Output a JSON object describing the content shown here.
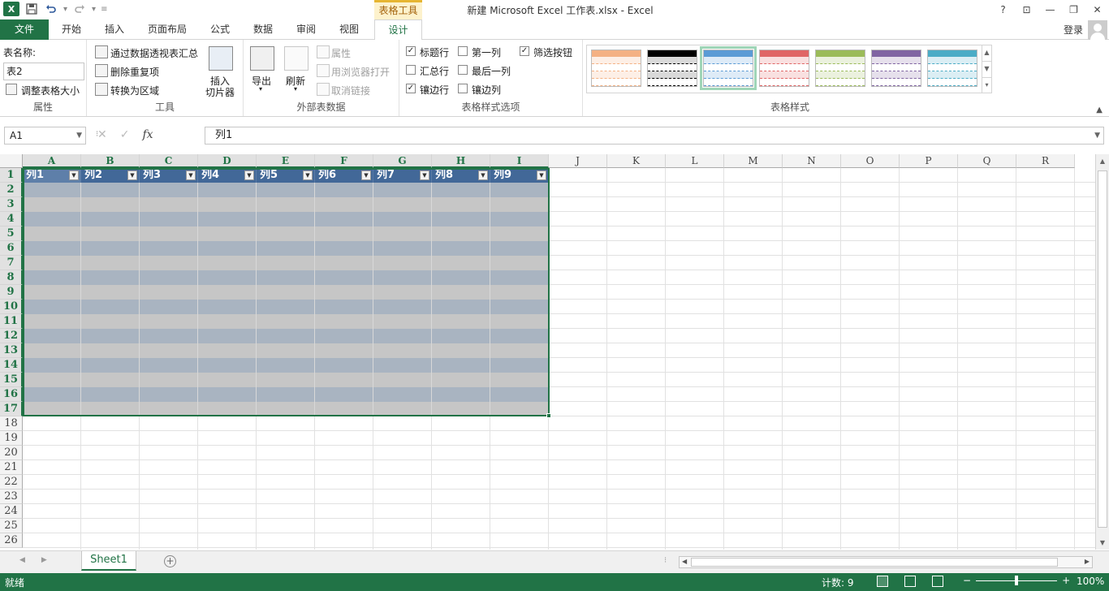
{
  "window": {
    "title": "新建 Microsoft Excel 工作表.xlsx - Excel",
    "context_tab_header": "表格工具",
    "help": "?",
    "controls": [
      "⊡",
      "—",
      "❐",
      "✕"
    ]
  },
  "ribbon_tabs": [
    "文件",
    "开始",
    "插入",
    "页面布局",
    "公式",
    "数据",
    "审阅",
    "视图",
    "设计"
  ],
  "active_tab": "设计",
  "account": {
    "login": "登录"
  },
  "ribbon": {
    "properties": {
      "label": "属性",
      "table_name_label": "表名称:",
      "table_name_value": "表2",
      "resize": "调整表格大小"
    },
    "tools": {
      "label": "工具",
      "pivot": "通过数据透视表汇总",
      "remove_dup": "删除重复项",
      "convert": "转换为区域",
      "slicer_l1": "插入",
      "slicer_l2": "切片器"
    },
    "external": {
      "label": "外部表数据",
      "export": "导出",
      "refresh": "刷新",
      "properties": "属性",
      "open_browser": "用浏览器打开",
      "unlink": "取消链接"
    },
    "style_options": {
      "label": "表格样式选项",
      "header_row": {
        "text": "标题行",
        "checked": true
      },
      "first_col": {
        "text": "第一列",
        "checked": false
      },
      "filter_btn": {
        "text": "筛选按钮",
        "checked": true
      },
      "total_row": {
        "text": "汇总行",
        "checked": false
      },
      "last_col": {
        "text": "最后一列",
        "checked": false
      },
      "banded_rows": {
        "text": "镶边行",
        "checked": true
      },
      "banded_cols": {
        "text": "镶边列",
        "checked": false
      }
    },
    "table_styles": {
      "label": "表格样式",
      "swatches": [
        "#f4b183",
        "#000000",
        "#5b9bd5",
        "#e06666",
        "#9bbb59",
        "#8064a2",
        "#4bacc6"
      ],
      "selected_index": 2
    }
  },
  "formula_bar": {
    "name_box": "A1",
    "cancel": "✕",
    "enter": "✓",
    "fx": "fx",
    "content": "列1"
  },
  "grid": {
    "columns": [
      "A",
      "B",
      "C",
      "D",
      "E",
      "F",
      "G",
      "H",
      "I",
      "J",
      "K",
      "L",
      "M",
      "N",
      "O",
      "P",
      "Q",
      "R"
    ],
    "rows": [
      "1",
      "2",
      "3",
      "4",
      "5",
      "6",
      "7",
      "8",
      "9",
      "10",
      "11",
      "12",
      "13",
      "14",
      "15",
      "16",
      "17",
      "18",
      "19",
      "20",
      "21",
      "22",
      "23",
      "24",
      "25",
      "26"
    ],
    "table_headers": [
      "列1",
      "列2",
      "列3",
      "列4",
      "列5",
      "列6",
      "列7",
      "列8",
      "列9"
    ],
    "table_rows": 16
  },
  "sheet_tabs": {
    "sheets": [
      "Sheet1"
    ],
    "add": "+"
  },
  "status_bar": {
    "ready": "就绪",
    "count": "计数: 9",
    "zoom": "100%",
    "zoom_minus": "−",
    "zoom_plus": "+",
    "zoom_level": 0.5
  },
  "colors": {
    "accent": "#217346",
    "table_header": "#426898",
    "band1": "#a9b4c1",
    "band2": "#c6c6c6"
  }
}
